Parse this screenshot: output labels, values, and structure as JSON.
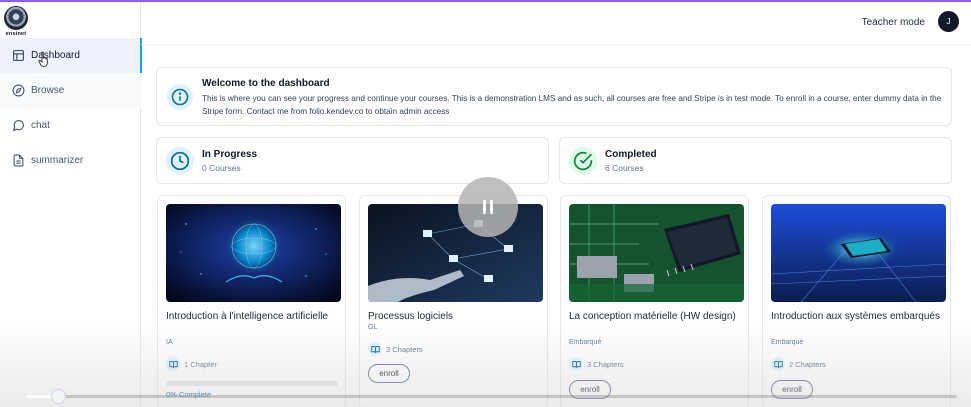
{
  "brand": {
    "logo_text": "ensinet"
  },
  "sidebar": {
    "items": [
      {
        "label": "Dashboard",
        "icon": "layout-icon"
      },
      {
        "label": "Browse",
        "icon": "compass-icon"
      },
      {
        "label": "chat",
        "icon": "message-circle-icon"
      },
      {
        "label": "summarizer",
        "icon": "file-text-icon"
      }
    ]
  },
  "header": {
    "mode_label": "Teacher mode",
    "avatar_initial": "J"
  },
  "welcome": {
    "title": "Welcome to the dashboard",
    "text": "This is where you can see your progress and continue your courses. This is a demonstration LMS and as such, all courses are free and Stripe is in test mode. To enroll in a course, enter dummy data in the Stripe form. Contact me from folio.kendev.co to obtain admin access",
    "icon": "info-icon"
  },
  "stats": {
    "in_progress": {
      "title": "In Progress",
      "count": "0 Courses",
      "icon": "clock-icon"
    },
    "completed": {
      "title": "Completed",
      "count": "6 Courses",
      "icon": "check-circle-icon"
    }
  },
  "courses": [
    {
      "title": "Introduction à l'intelligence artificielle",
      "category": "IA",
      "chapters": "1 Chapter",
      "progress_text": "0% Complete",
      "progress": 0
    },
    {
      "title": "Processus logiciels",
      "category": "GL",
      "chapters": "3 Chapters",
      "enroll_label": "enroll"
    },
    {
      "title": "La conception matérielle (HW design)",
      "category": "Embarqué",
      "chapters": "3 Chapters",
      "enroll_label": "enroll"
    },
    {
      "title": "Introduction aux systèmes embarqués",
      "category": "Embarqué",
      "chapters": "2 Chapters",
      "enroll_label": "enroll"
    }
  ],
  "video_player": {
    "state": "paused",
    "playback_progress": 0.034
  },
  "colors": {
    "accent": "#0ea5e9",
    "top_border": "#8b5cf6",
    "active_nav_bg": "#eef2ff"
  }
}
